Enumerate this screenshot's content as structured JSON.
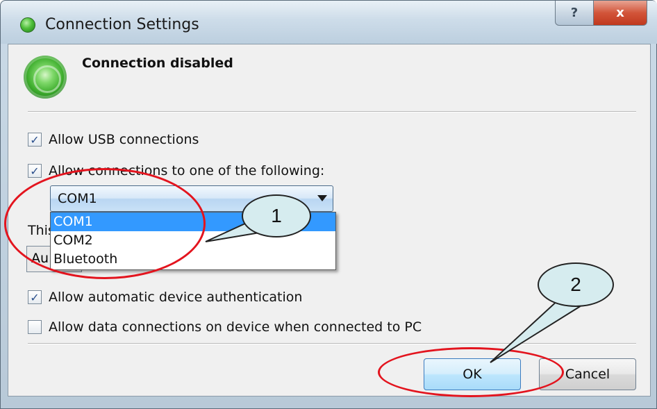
{
  "window": {
    "title": "Connection Settings",
    "help_label": "?",
    "close_label": "x"
  },
  "status": {
    "title": "Connection disabled",
    "icon": "connection-status-icon"
  },
  "options": {
    "allow_usb": {
      "label": "Allow USB connections",
      "checked": true
    },
    "allow_following": {
      "label": "Allow connections to one of the following:",
      "checked": true
    },
    "port_select": {
      "value": "COM1",
      "options": [
        "COM1",
        "COM2",
        "Bluetooth"
      ],
      "selected_index": 0
    },
    "hidden_label": "This",
    "hidden_input": "Au",
    "allow_auth": {
      "label": "Allow automatic device authentication",
      "checked": true
    },
    "allow_data": {
      "label": "Allow data connections on device when connected to PC",
      "checked": false
    }
  },
  "buttons": {
    "ok_label": "OK",
    "cancel_label": "Cancel"
  },
  "annotations": {
    "callout_1": "1",
    "callout_2": "2",
    "highlight_color": "#e3141e",
    "callout_color": "#d6ecef"
  }
}
